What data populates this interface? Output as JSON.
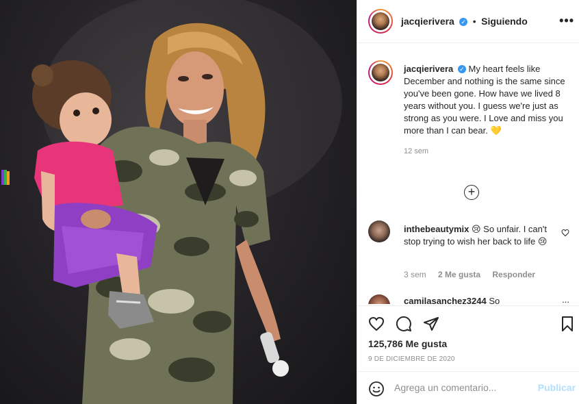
{
  "colors": {
    "accent": "#3897f0",
    "publish_disabled": "#b2dffc",
    "meta_gray": "#8e8e8e",
    "heart_emoji": "#f7c52b"
  },
  "header": {
    "username": "jacqierivera",
    "verified_icon": "verified-badge-icon",
    "separator": "•",
    "follow_label": "Siguiendo",
    "more_label": "•••"
  },
  "caption": {
    "username": "jacqierivera",
    "text": "My heart feels like December and nothing is the same since you've been gone. How have we lived 8 years without you. I guess we're just as strong as you were. I Love and miss you more than I can bear.",
    "emoji": "💛",
    "time": "12 sem"
  },
  "load_more_icon": "plus-circle-icon",
  "comments": [
    {
      "username": "inthebeautymix",
      "emoji_start": "😢",
      "text": "So unfair. I can't stop trying to wish her back to life",
      "emoji_end": "😢",
      "time": "3 sem",
      "likes": "2 Me gusta",
      "reply": "Responder"
    },
    {
      "username": "camilasanchez3244",
      "text": "So",
      "more": "..."
    }
  ],
  "actions": {
    "like_icon": "heart-icon",
    "comment_icon": "comment-icon",
    "share_icon": "share-icon",
    "save_icon": "bookmark-icon",
    "likes_text": "125,786 Me gusta",
    "date": "9 DE DICIEMBRE DE 2020"
  },
  "add_comment": {
    "placeholder": "Agrega un comentario...",
    "publish_label": "Publicar",
    "emoji_icon": "smiley-icon"
  }
}
